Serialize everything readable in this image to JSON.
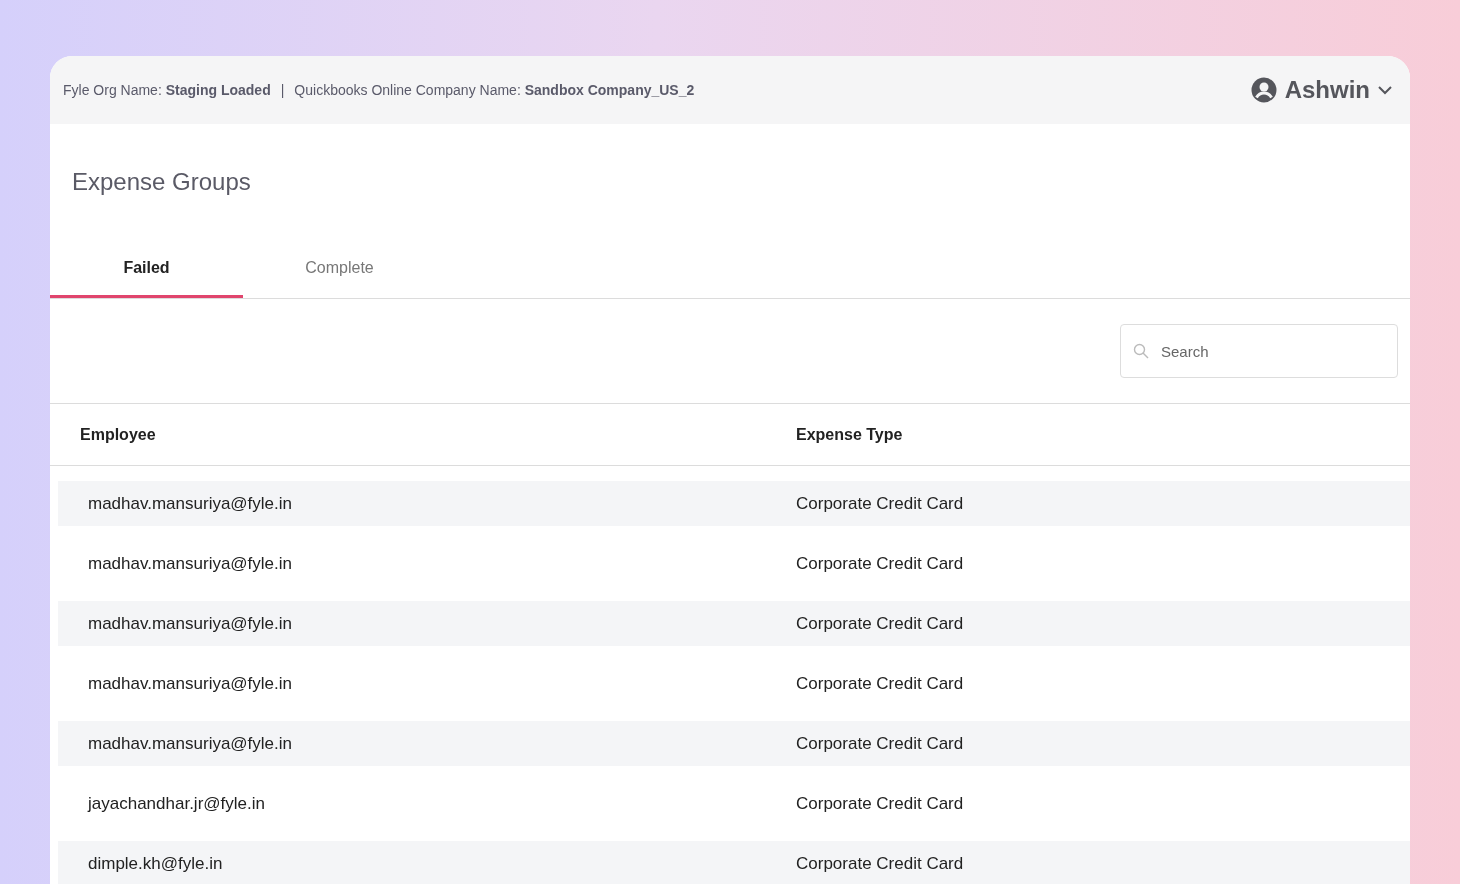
{
  "header": {
    "org": "Fyle Org Name: **Staging Loaded**",
    "separator": "|",
    "company": "Quickbooks Online Company Name: **Sandbox Company_US_2**",
    "user": "Ashwin"
  },
  "title": "Expense Groups",
  "tabs": [
    {
      "label": "Failed",
      "selected": true
    },
    {
      "label": "Complete",
      "selected": false
    }
  ],
  "search": {
    "placeholder": "Search"
  },
  "table": {
    "columns": [
      "Employee",
      "Expense Type"
    ],
    "rows": [
      [
        "madhav.mansuriya@fyle.in",
        "Corporate Credit Card"
      ],
      [
        "madhav.mansuriya@fyle.in",
        "Corporate Credit Card"
      ],
      [
        "madhav.mansuriya@fyle.in",
        "Corporate Credit Card"
      ],
      [
        "madhav.mansuriya@fyle.in",
        "Corporate Credit Card"
      ],
      [
        "madhav.mansuriya@fyle.in",
        "Corporate Credit Card"
      ],
      [
        "jayachandhar.jr@fyle.in",
        "Corporate Credit Card"
      ],
      [
        "dimple.kh@fyle.in",
        "Corporate Credit Card"
      ]
    ]
  }
}
